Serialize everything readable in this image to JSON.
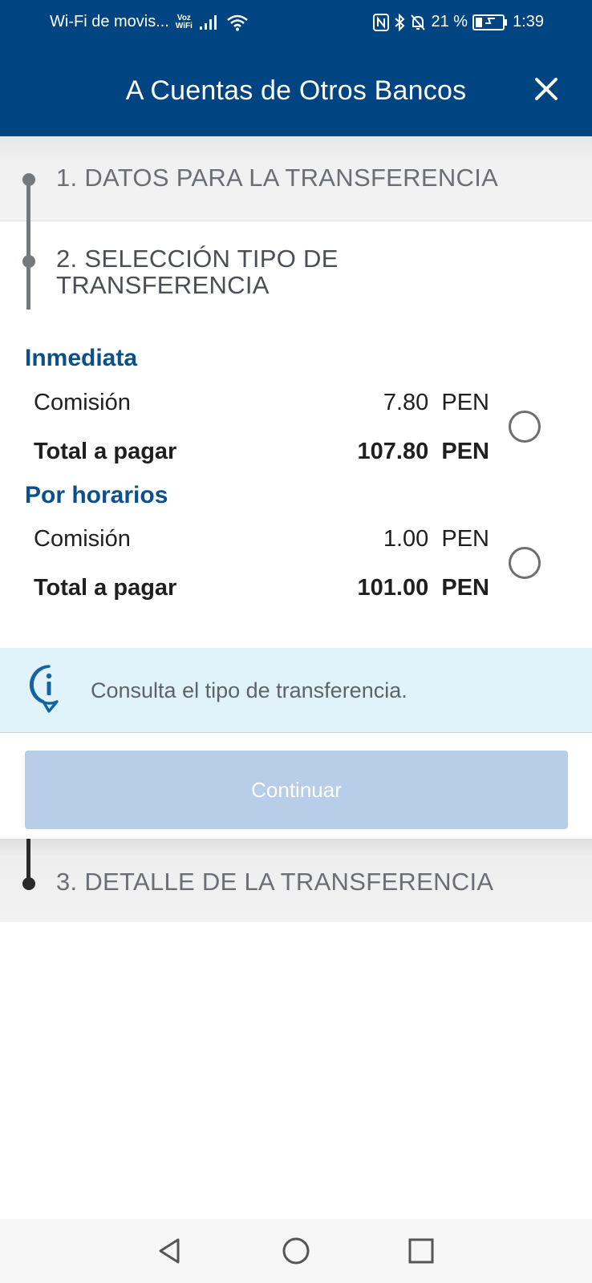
{
  "status_bar": {
    "carrier": "Wi-Fi de movis...",
    "voz_wifi_top": "Voz",
    "voz_wifi_bottom": "WiFi",
    "battery_percent": "21 %",
    "time": "1:39",
    "icons": [
      "signal-icon",
      "wifi-icon",
      "nfc-icon",
      "bluetooth-icon",
      "mute-icon",
      "battery-icon"
    ]
  },
  "header": {
    "title": "A Cuentas de Otros Bancos",
    "close_icon": "close-icon"
  },
  "steps": {
    "step1": "1. DATOS PARA LA TRANSFERENCIA",
    "step2": "2. SELECCIÓN TIPO DE TRANSFERENCIA",
    "step3": "3. DETALLE DE LA TRANSFERENCIA"
  },
  "options": [
    {
      "title": "Inmediata",
      "commission_label": "Comisión",
      "commission_value": "7.80  PEN",
      "total_label": "Total a pagar",
      "total_value": "107.80  PEN",
      "selected": false
    },
    {
      "title": "Por horarios",
      "commission_label": "Comisión",
      "commission_value": "1.00  PEN",
      "total_label": "Total a pagar",
      "total_value": "101.00  PEN",
      "selected": false
    }
  ],
  "info": {
    "text": "Consulta el tipo de transferencia.",
    "icon": "info-icon"
  },
  "continue_button": {
    "label": "Continuar",
    "enabled": false
  },
  "colors": {
    "primary": "#004481",
    "option_title": "#0b4f8c",
    "info_bg": "#e1f3fa",
    "button_disabled": "#b8cde8"
  },
  "nav_bar": {
    "icons": [
      "back-icon",
      "home-icon",
      "recents-icon"
    ]
  }
}
